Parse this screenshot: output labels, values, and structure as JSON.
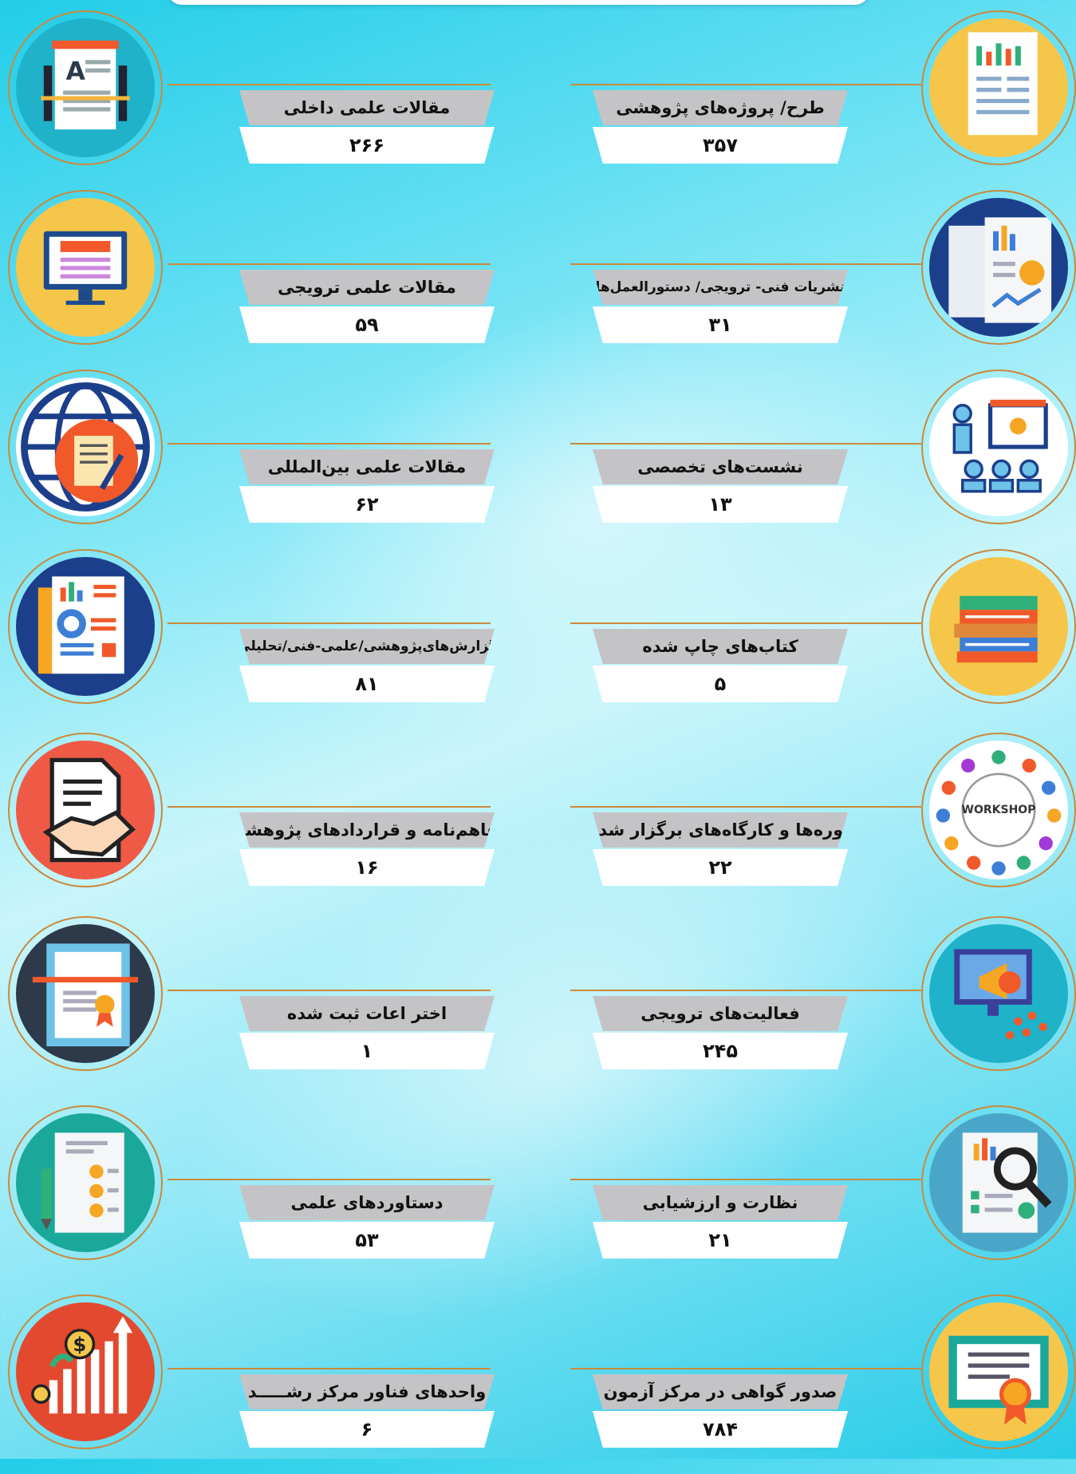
{
  "items": [
    {
      "label": "مقالات علمی داخلی",
      "value": "۲۶۶",
      "icon": "article-icon"
    },
    {
      "label": "طرح/ پروژه‌های پژوهشی",
      "value": "۳۵۷",
      "icon": "report-chart-icon"
    },
    {
      "label": "مقالات علمی ترویجی",
      "value": "۵۹",
      "icon": "monitor-icon"
    },
    {
      "label": "نشریات فنی- ترویجی/ دستورالعمل‌ها",
      "value": "۳۱",
      "icon": "publication-icon"
    },
    {
      "label": "مقالات علمی بین‌المللی",
      "value": "۶۲",
      "icon": "globe-document-icon"
    },
    {
      "label": "نشست‌های تخصصی",
      "value": "۱۳",
      "icon": "meeting-icon"
    },
    {
      "label": "گزارش‌های‌پژوهشی/علمی-فنی/تحلیلی",
      "value": "۸۱",
      "icon": "report-icon"
    },
    {
      "label": "کتاب‌های چاپ شده",
      "value": "۵",
      "icon": "books-icon"
    },
    {
      "label": "تفاهم‌نامه و قراردادهای پژوهشی",
      "value": "۱۶",
      "icon": "handshake-icon"
    },
    {
      "label": "دوره‌ها و کارگاه‌های برگزار شده",
      "value": "۲۲",
      "icon": "workshop-icon",
      "icon_text": "WORKSHOP"
    },
    {
      "label": "اختر اعات ثبت شده",
      "value": "۱",
      "icon": "patent-icon"
    },
    {
      "label": "فعالیت‌های ترویجی",
      "value": "۲۴۵",
      "icon": "megaphone-icon"
    },
    {
      "label": "دستاوردهای علمی",
      "value": "۵۳",
      "icon": "checklist-icon"
    },
    {
      "label": "نظارت و ارزشیابی",
      "value": "۲۱",
      "icon": "magnifier-icon"
    },
    {
      "label": "واحدهای فناور مرکز رشـــــد",
      "value": "۶",
      "icon": "growth-icon"
    },
    {
      "label": "صدور گواهی در مرکز آزمون",
      "value": "۷۸۴",
      "icon": "certificate-icon"
    }
  ]
}
